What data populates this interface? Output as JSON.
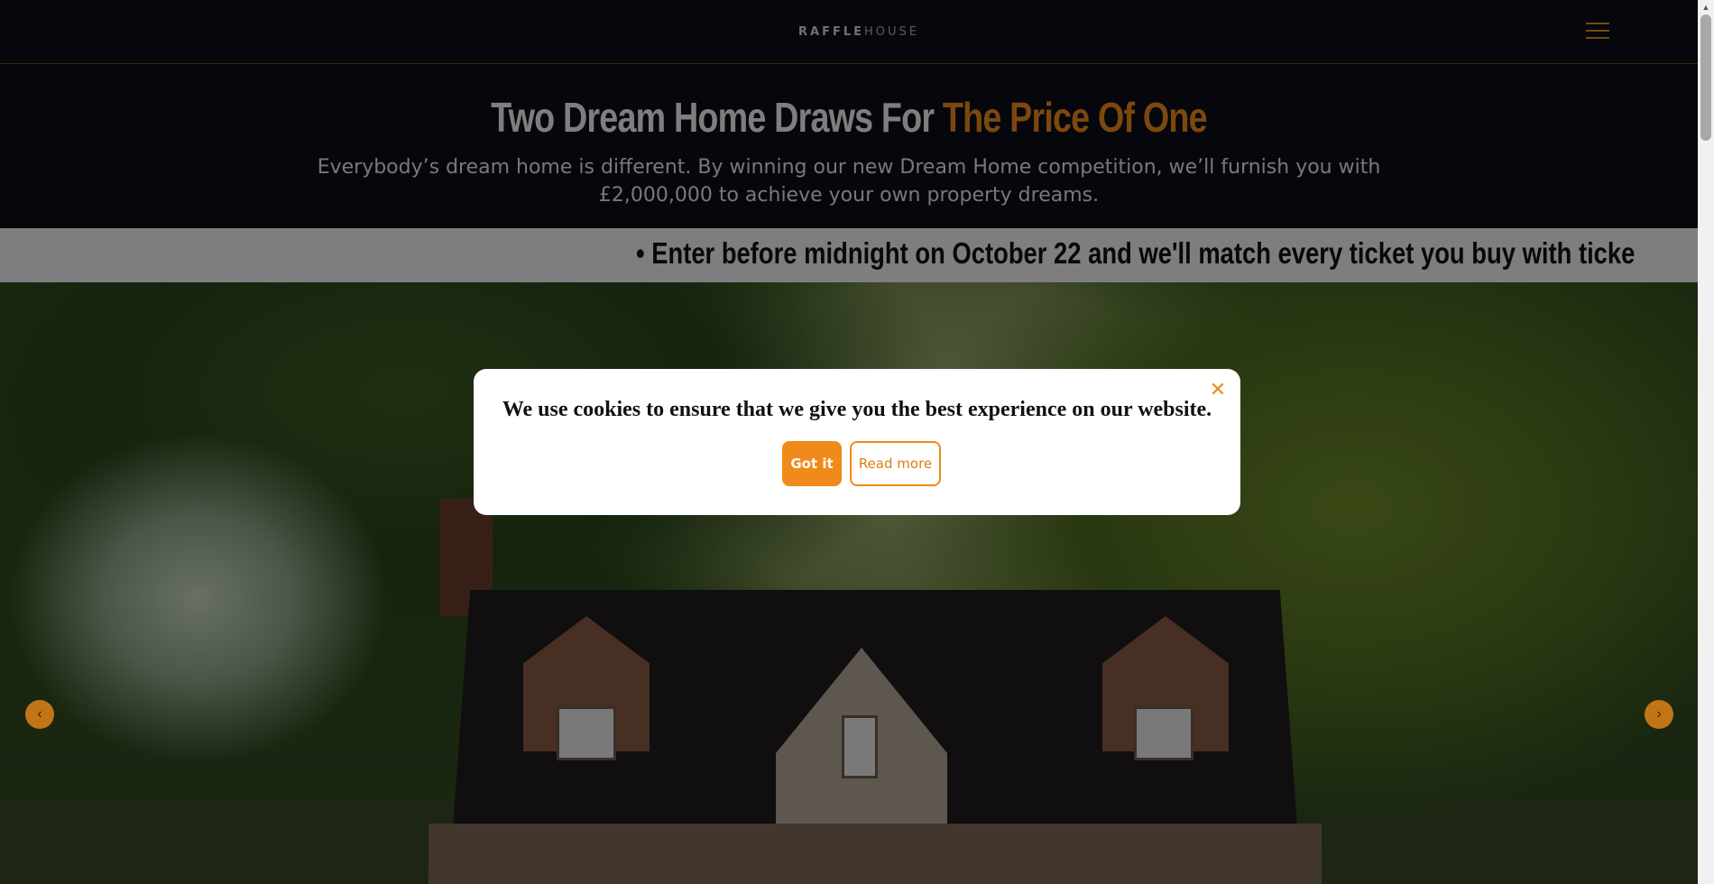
{
  "header": {
    "logo_bold": "RAFFLE",
    "logo_light": "HOUSE",
    "menu_icon": "hamburger-menu-icon"
  },
  "hero": {
    "title_main": "Two Dream Home Draws For ",
    "title_accent": "The Price Of One",
    "description": "Everybody’s dream home is different. By winning our new Dream Home competition, we’ll furnish you with £2,000,000 to achieve your own property dreams."
  },
  "ticker": {
    "text": "• Enter before midnight on October 22 and we'll match every ticket you buy with ticke"
  },
  "carousel": {
    "prev_icon": "chevron-left-icon",
    "next_icon": "chevron-right-icon",
    "prev_glyph": "‹",
    "next_glyph": "›"
  },
  "cookie_modal": {
    "message": "We use cookies to ensure that we give you the best experience on our website.",
    "accept_label": "Got it",
    "read_more_label": "Read more",
    "close_glyph": "✕"
  },
  "colors": {
    "accent": "#f08a1a",
    "header_bg": "#0b0e18",
    "ticker_bg": "#f2f2f2"
  }
}
